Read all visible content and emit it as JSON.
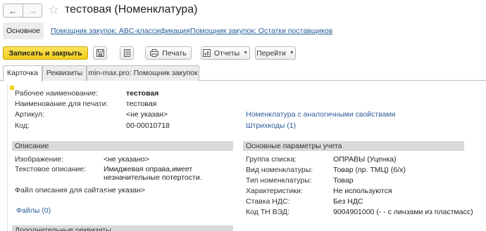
{
  "window": {
    "back_glyph": "←",
    "forward_glyph": "→",
    "star_glyph": "☆",
    "title": "тестовая (Номенклатура)"
  },
  "sections": {
    "main": "Основное",
    "abc": "Помощник закупок: ABC-классификация",
    "stock": "Помощник закупок: Остатки поставщиков"
  },
  "toolbar": {
    "save_close": "Записать и закрыть",
    "print": "Печать",
    "reports": "Отчеты",
    "goto": "Перейти"
  },
  "tabs": {
    "card": "Карточка",
    "props": "Реквизиты",
    "helper": "min-max.pro: Помощник закупок"
  },
  "card": {
    "work_name_label": "Рабочее наименование:",
    "work_name_value": "тестовая",
    "print_name_label": "Наименование для печати:",
    "print_name_value": "тестовая",
    "article_label": "Артикул:",
    "article_value": "<не указан>",
    "code_label": "Код:",
    "code_value": "00-00010718",
    "similar_link": "Номенклатура с аналогичными свойствами",
    "barcodes_link": "Штрихкоды (1)"
  },
  "description": {
    "header": "Описание",
    "image_label": "Изображение:",
    "image_value": "<не указано>",
    "text_label": "Текстовое описание:",
    "text_value_line1": "Имиджевая оправа,имеет",
    "text_value_line2": "незначительные потертости.",
    "site_file_label": "Файл описания для сайта:",
    "site_file_value": "<не указан>",
    "files_link": "Файлы (0)"
  },
  "accounting": {
    "header": "Основные параметры учета",
    "group_label": "Группа списка:",
    "group_value": "ОПРАВЫ  (Уценка)",
    "kind_label": "Вид номенклатуры:",
    "kind_value": "Товар (пр. ТМЦ) (б/х)",
    "type_label": "Тип номенклатуры:",
    "type_value": "Товар",
    "chars_label": "Характеристики:",
    "chars_value": "Не используются",
    "vat_label": "Ставка НДС:",
    "vat_value": "Без НДС",
    "tnved_label": "Код ТН ВЭД:",
    "tnved_value": "9004901000 (- - с линзами из пластмасс)"
  },
  "additional": {
    "header": "Дополнительные реквизиты"
  },
  "colors": {
    "accent_yellow": "#f2cd19",
    "link_blue": "#2b5d99",
    "group_header_gray": "#d9d9d9"
  }
}
